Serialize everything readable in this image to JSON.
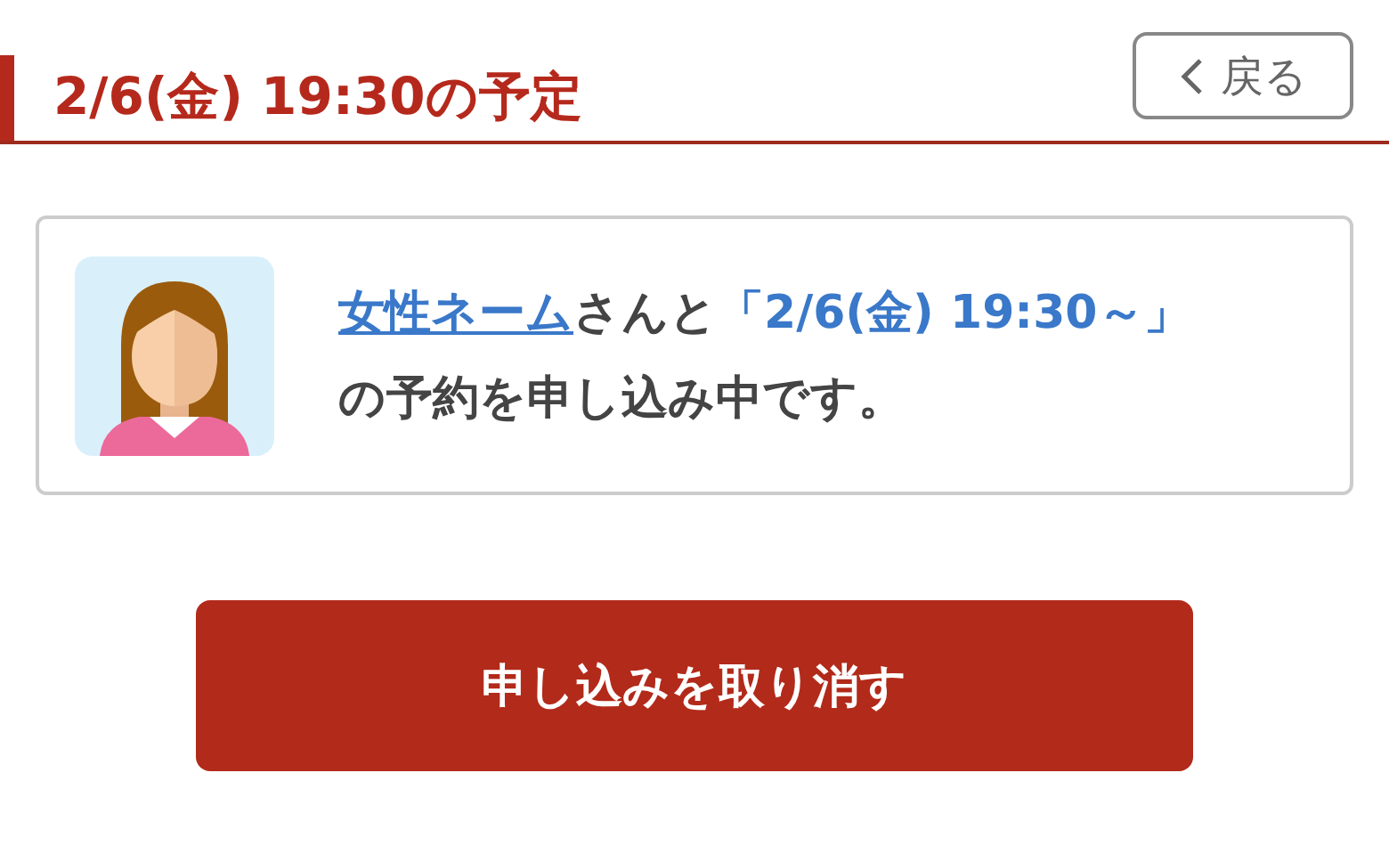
{
  "header": {
    "title": "2/6(金) 19:30の予定",
    "back_button": "戻る"
  },
  "notice": {
    "name_link": "女性ネーム",
    "text_after_name": "さんと",
    "date": "「2/6(金) 19:30～」",
    "text_end": "の予約を申し込み中です。"
  },
  "cancel_button": "申し込みを取り消す"
}
